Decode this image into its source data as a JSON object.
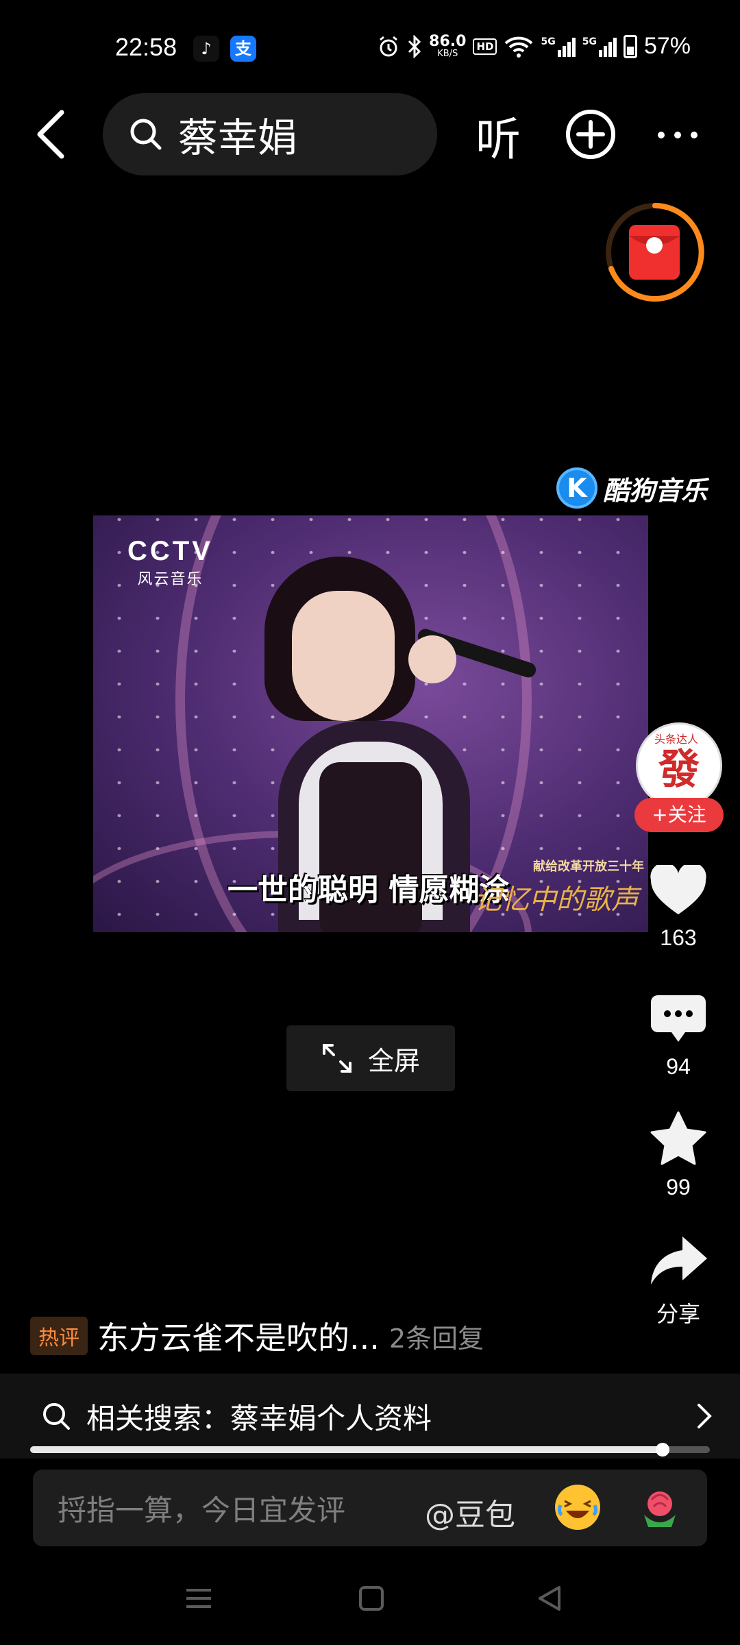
{
  "status_bar": {
    "time": "22:58",
    "net_speed": "86.0",
    "net_unit": "KB/S",
    "hd_label": "HD",
    "signal1": "5G",
    "signal2": "5G",
    "battery": "57%",
    "battery_level": 0.57
  },
  "top_bar": {
    "search_query": "蔡幸娟",
    "listen_label": "听"
  },
  "video": {
    "watermark_app": "酷狗音乐",
    "channel_logo": "CCTV",
    "channel_sub": "风云音乐",
    "subtitle": "一世的聪明  情愿糊涂",
    "corner_tag": "献给改革开放三十年",
    "corner_sign": "记忆中的歌声"
  },
  "fullscreen_label": "全屏",
  "author": {
    "avatar_char": "發",
    "avatar_tag": "头条达人",
    "follow_label": "+关注"
  },
  "actions": {
    "likes": "163",
    "comments": "94",
    "favorites": "99",
    "share_label": "分享"
  },
  "hot_comment": {
    "tag": "热评",
    "text": "东方云雀不是吹的...",
    "replies": "2条回复"
  },
  "related_search": {
    "label": "相关搜索：蔡幸娟个人资料"
  },
  "progress": {
    "fraction": 0.93
  },
  "comment_input": {
    "placeholder": "捋指一算，今日宜发评",
    "mention": "@豆包"
  }
}
